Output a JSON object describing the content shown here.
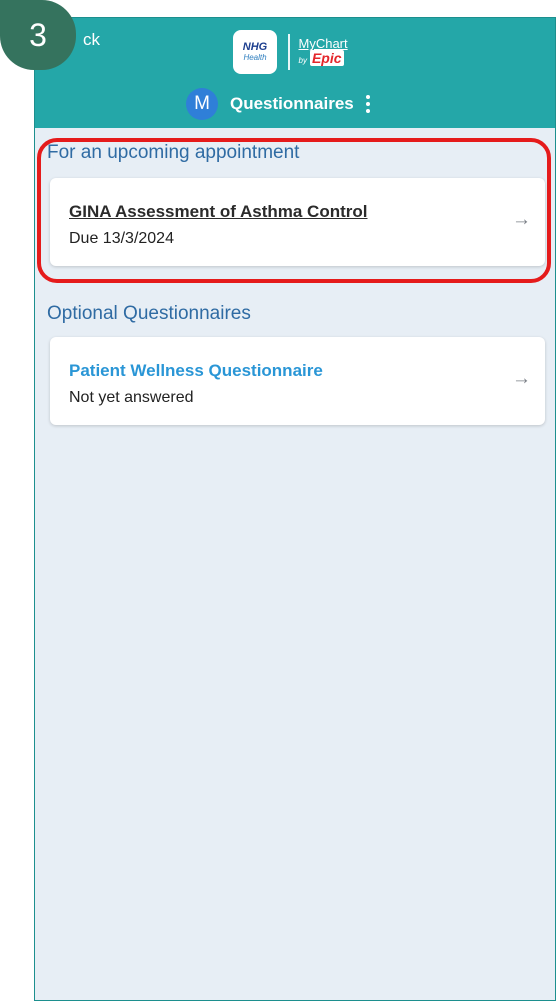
{
  "step_badge": "3",
  "header": {
    "back_label": "ck",
    "logo": {
      "nhg_main": "NHG",
      "nhg_sub": "Health",
      "mychart_name": "MyChart",
      "mychart_by": "by",
      "mychart_epic": "Epic"
    },
    "avatar_initial": "M",
    "title": "Questionnaires",
    "more_icon": "kebab-vertical-icon"
  },
  "sections": [
    {
      "heading": "For an upcoming appointment",
      "items": [
        {
          "title": "GINA Assessment of Asthma Control",
          "subtitle": "Due 13/3/2024",
          "arrow_icon": "arrow-right-icon"
        }
      ]
    },
    {
      "heading": "Optional Questionnaires",
      "items": [
        {
          "title": "Patient Wellness Questionnaire",
          "subtitle": "Not yet answered",
          "arrow_icon": "arrow-right-icon"
        }
      ]
    }
  ],
  "colors": {
    "header_bg": "#24a7a8",
    "page_bg": "#e7eef5",
    "highlight_border": "#e51b1b",
    "link_blue": "#2a96d6",
    "heading_blue": "#2f6ba3",
    "step_badge_bg": "#35735e"
  }
}
